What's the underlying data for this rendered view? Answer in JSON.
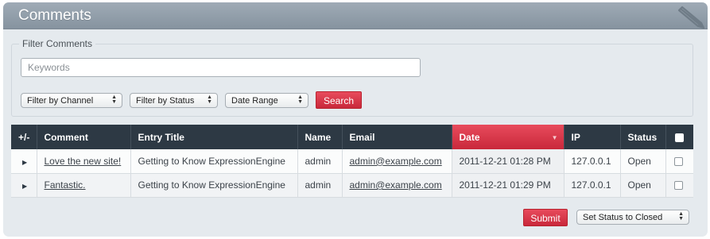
{
  "header": {
    "title": "Comments",
    "icon": "pencil-icon"
  },
  "filter": {
    "legend": "Filter Comments",
    "keywords_placeholder": "Keywords",
    "channel_select": "Filter by Channel",
    "status_select": "Filter by Status",
    "date_select": "Date Range",
    "search_label": "Search"
  },
  "table": {
    "columns": [
      "+/-",
      "Comment",
      "Entry Title",
      "Name",
      "Email",
      "Date",
      "IP",
      "Status"
    ],
    "sorted_column": "Date",
    "sort_direction": "desc",
    "rows": [
      {
        "comment": "Love the new site!",
        "entry_title": "Getting to Know ExpressionEngine",
        "name": "admin",
        "email": "admin@example.com",
        "date": "2011-12-21 01:28 PM",
        "ip": "127.0.0.1",
        "status": "Open"
      },
      {
        "comment": "Fantastic.",
        "entry_title": "Getting to Know ExpressionEngine",
        "name": "admin",
        "email": "admin@example.com",
        "date": "2011-12-21 01:29 PM",
        "ip": "127.0.0.1",
        "status": "Open"
      }
    ]
  },
  "footer": {
    "submit_label": "Submit",
    "action_select": "Set Status to Closed"
  },
  "colors": {
    "accent": "#d63446",
    "header_dark": "#2d3944",
    "panel_bg": "#e5eaee"
  }
}
